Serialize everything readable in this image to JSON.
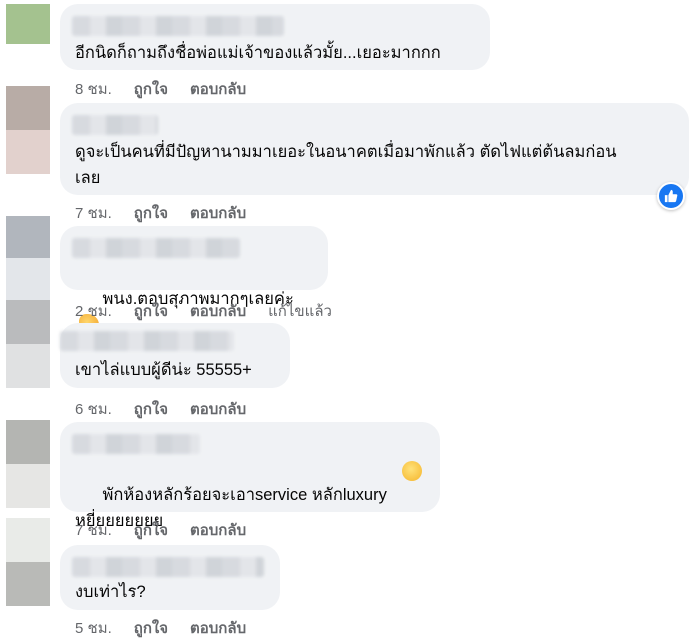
{
  "actions": {
    "like": "ถูกใจ",
    "reply": "ตอบกลับ",
    "edited": "แก้ไขแล้ว"
  },
  "comments": [
    {
      "time": "8 ชม.",
      "text": "อีกนิดก็ถามถึงชื่อพ่อแม่เจ้าของแล้วมั้ย...เยอะมากกก"
    },
    {
      "time": "7 ชม.",
      "text": "ดูจะเป็นคนที่มีปัญหานามมาเยอะในอนาคตเมื่อมาพักแล้ว ตัดไฟแต่ต้นลมก่อน\nเลย",
      "reactions": "like"
    },
    {
      "time": "2 ชม.",
      "text": "พนง.ตอบสุภาพมากๆเลยค่ะ",
      "emoji": "clapping-hands"
    },
    {
      "time": "6 ชม.",
      "text": "เขาไล่แบบผู้ดีน่ะ 55555+"
    },
    {
      "time": "7 ชม.",
      "text": "พักห้องหลักร้อยจะเอาservice หลักluxury\nหยี่ยยยยยยย",
      "emoji": "grinning-sweat"
    },
    {
      "time": "5 ชม.",
      "text": "งบเท่าไร?"
    }
  ]
}
